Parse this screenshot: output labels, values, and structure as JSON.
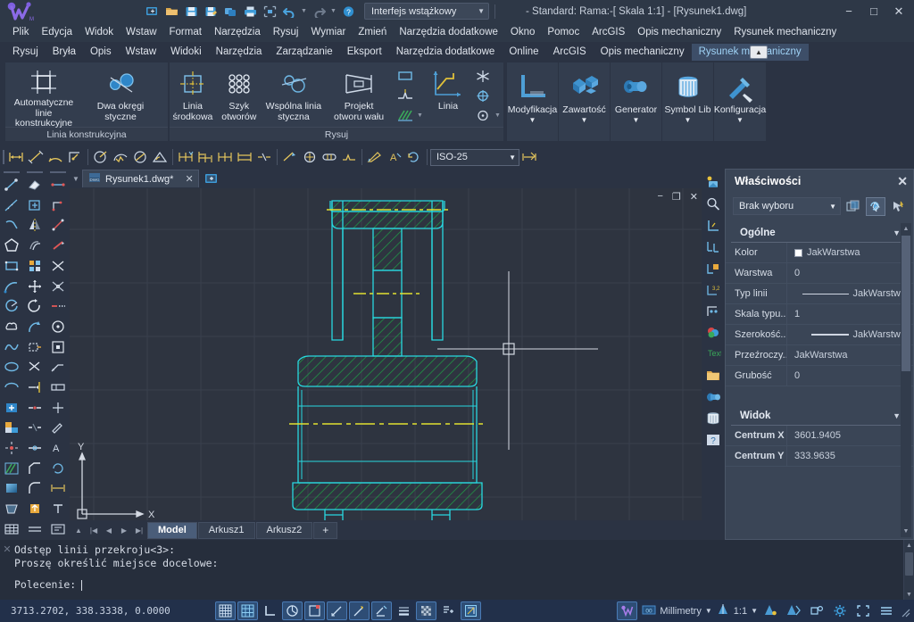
{
  "window": {
    "title": "- Standard: Rama:-[ Skala 1:1] - [Rysunek1.dwg]",
    "workspace_value": "Interfejs wstążkowy",
    "minimize": "−",
    "maximize": "□",
    "close": "✕"
  },
  "quick_access": [
    {
      "name": "new-icon",
      "glyph": "new"
    },
    {
      "name": "open-icon",
      "glyph": "open"
    },
    {
      "name": "save-icon",
      "glyph": "save"
    },
    {
      "name": "save-as-icon",
      "glyph": "saveas"
    },
    {
      "name": "plot-preview-icon",
      "glyph": "plotprev"
    },
    {
      "name": "print-icon",
      "glyph": "print"
    },
    {
      "name": "plot-region-icon",
      "glyph": "plotregion"
    },
    {
      "name": "undo-icon",
      "glyph": "undo"
    },
    {
      "name": "redo-icon",
      "glyph": "redo"
    },
    {
      "name": "help-icon",
      "glyph": "help"
    }
  ],
  "menu": [
    "Plik",
    "Edycja",
    "Widok",
    "Wstaw",
    "Format",
    "Narzędzia",
    "Rysuj",
    "Wymiar",
    "Zmień",
    "Narzędzia dodatkowe",
    "Okno",
    "Pomoc",
    "ArcGIS",
    "Opis mechaniczny",
    "Rysunek mechaniczny"
  ],
  "ribbon_tabs": [
    {
      "label": "Rysuj",
      "active": false
    },
    {
      "label": "Bryła",
      "active": false
    },
    {
      "label": "Opis",
      "active": false
    },
    {
      "label": "Wstaw",
      "active": false
    },
    {
      "label": "Widoki",
      "active": false
    },
    {
      "label": "Narzędzia",
      "active": false
    },
    {
      "label": "Zarządzanie",
      "active": false
    },
    {
      "label": "Eksport",
      "active": false
    },
    {
      "label": "Narzędzia dodatkowe",
      "active": false
    },
    {
      "label": "Online",
      "active": false
    },
    {
      "label": "ArcGIS",
      "active": false
    },
    {
      "label": "Opis mechaniczny",
      "active": false
    },
    {
      "label": "Rysunek mechaniczny",
      "active": true
    }
  ],
  "ribbon_panels": [
    {
      "title": "Linia konstrukcyjna",
      "buttons": [
        {
          "label": "Automatyczne linie\nkonstrukcyjne",
          "dropdown": true,
          "icon": "construction-lines-icon"
        },
        {
          "label": "Dwa okręgi\nstyczne",
          "dropdown": true,
          "icon": "two-tangent-circles-icon"
        }
      ]
    },
    {
      "title": "Rysuj",
      "buttons": [
        {
          "label": "Linia\nśrodkowa",
          "dropdown": false,
          "icon": "center-line-icon"
        },
        {
          "label": "Szyk\notworów",
          "dropdown": false,
          "icon": "hole-array-icon"
        },
        {
          "label": "Wspólna linia\nstyczna",
          "dropdown": false,
          "icon": "common-tangent-icon"
        },
        {
          "label": "Projekt\notworu wału",
          "dropdown": true,
          "icon": "shaft-hole-icon"
        },
        {
          "label": "Linia",
          "dropdown": false,
          "icon": "line-icon"
        }
      ],
      "small_icons": [
        "rectangle-icon",
        "section-line-icon",
        "star-burst-icon",
        "break-line-icon",
        "crosshair-target-icon",
        "hatch-icon",
        "circle-center-icon"
      ]
    }
  ],
  "ribbon_right_buttons": [
    {
      "label": "Modyfikacja",
      "dropdown": true,
      "icon": "modify-icon"
    },
    {
      "label": "Zawartość",
      "dropdown": true,
      "icon": "content-icon"
    },
    {
      "label": "Generator",
      "dropdown": true,
      "icon": "generator-icon"
    },
    {
      "label": "Symbol\nLib",
      "dropdown": true,
      "icon": "symbol-library-icon"
    },
    {
      "label": "Konfiguracja",
      "dropdown": true,
      "icon": "configuration-icon"
    }
  ],
  "dim_toolbar": {
    "style_value": "ISO-25",
    "icons": [
      "linear-dimension-icon",
      "aligned-dimension-icon",
      "arc-length-icon",
      "ordinate-dimension-icon",
      "radius-dimension-icon",
      "jogged-radius-icon",
      "diameter-dimension-icon",
      "angular-dimension-icon",
      "quick-dimension-icon",
      "baseline-dimension-icon",
      "continue-dimension-icon",
      "dimension-space-icon",
      "dimension-break-icon",
      "tolerance-icon",
      "center-mark-icon",
      "inspect-icon",
      "jogged-linear-icon",
      "edit-dimension-icon",
      "edit-dim-text-icon",
      "dimension-update-icon",
      "dimension-style-icon"
    ]
  },
  "left_palette": {
    "column1": [
      "line-icon",
      "construction-line-icon",
      "polyline-icon",
      "polygon-icon",
      "rectangle-icon",
      "arc-icon",
      "circle-icon",
      "revision-cloud-icon",
      "spline-icon",
      "ellipse-icon",
      "ellipse-arc-icon",
      "insert-block-icon",
      "make-block-icon",
      "point-icon",
      "hatch-icon",
      "gradient-icon",
      "region-icon",
      "table-icon"
    ],
    "column2": [
      "erase-icon",
      "copy-icon",
      "mirror-icon",
      "offset-icon",
      "array-icon",
      "move-icon",
      "rotate-icon",
      "scale-icon",
      "stretch-icon",
      "trim-icon",
      "extend-icon",
      "break-at-point-icon",
      "break-icon",
      "join-icon",
      "chamfer-icon",
      "fillet-icon",
      "explode-icon",
      "multiline-icon"
    ],
    "column3": [
      "dimension-linear-icon",
      "dimension-ordinate-icon",
      "dimension-aligned-icon",
      "dimension-radius-icon",
      "dimension-diameter-icon",
      "dimension-angular-icon",
      "quick-dimension-icon",
      "dimension-baseline-icon",
      "dimension-continue-icon",
      "leader-icon",
      "tolerance-icon",
      "center-mark-icon",
      "dimension-edit-icon",
      "dimension-text-edit-icon",
      "dimension-update-icon",
      "dimension-style-icon",
      "text-icon",
      "mtext-icon"
    ]
  },
  "right_palette": [
    "render-icon",
    "zoom-icon",
    "ucs-icon",
    "ucs-manager-icon",
    "ucs-named-icon",
    "ucs-move-icon",
    "ucs-origin-icon",
    "color-icon",
    "text-style-icon",
    "layer-icon",
    "layer-tools-icon",
    "delete-layer-icon",
    "help-icon"
  ],
  "document_tab": {
    "label": "Rysunek1.dwg*",
    "close": "✕"
  },
  "canvas": {
    "minimize": "−",
    "restore": "❐",
    "close": "✕",
    "ucs_x_label": "X",
    "ucs_y_label": "Y"
  },
  "layout_tabs": [
    {
      "label": "Model",
      "active": true
    },
    {
      "label": "Arkusz1",
      "active": false
    },
    {
      "label": "Arkusz2",
      "active": false
    },
    {
      "label": "+",
      "active": false
    }
  ],
  "command_line": {
    "history": [
      "Odstęp linii przekroju<3>:",
      "Proszę określić miejsce docelowe:"
    ],
    "prompt": "Polecenie:"
  },
  "status_bar": {
    "coords": "3713.2702, 338.3338, 0.0000",
    "left_toggles": [
      {
        "name": "grid-display-toggle",
        "on": true
      },
      {
        "name": "snap-mode-toggle",
        "on": true
      },
      {
        "name": "ortho-mode-toggle",
        "on": false
      },
      {
        "name": "polar-tracking-toggle",
        "on": true
      },
      {
        "name": "object-snap-toggle",
        "on": true
      },
      {
        "name": "object-snap-tracking-toggle",
        "on": true
      },
      {
        "name": "dynamic-ucs-toggle",
        "on": true
      },
      {
        "name": "dynamic-input-toggle",
        "on": true
      },
      {
        "name": "lineweight-toggle",
        "on": false
      },
      {
        "name": "transparency-toggle",
        "on": true
      },
      {
        "name": "quick-properties-toggle",
        "on": false
      },
      {
        "name": "selection-cycling-toggle",
        "on": true
      }
    ],
    "unit_label": "Millimetry",
    "scale_label": "1:1",
    "right_icons": [
      "annotation-visibility-icon",
      "annotation-scale-auto-icon",
      "workspace-switch-icon",
      "settings-icon",
      "fullscreen-icon",
      "customization-icon"
    ]
  },
  "properties": {
    "title": "Właściwości",
    "close": "✕",
    "selection_value": "Brak wyboru",
    "tool_buttons": [
      {
        "name": "select-objects-button",
        "active": false
      },
      {
        "name": "quick-select-button",
        "active": true
      },
      {
        "name": "pick-filter-button",
        "active": false
      }
    ],
    "groups": [
      {
        "name": "Ogólne",
        "rows": [
          {
            "key": "Kolor",
            "value": "JakWarstwa",
            "type": "color"
          },
          {
            "key": "Warstwa",
            "value": "0",
            "type": "text"
          },
          {
            "key": "Typ linii",
            "value": "JakWarstwa",
            "type": "linetype"
          },
          {
            "key": "Skala typu...",
            "value": "1",
            "type": "text"
          },
          {
            "key": "Szerokość...",
            "value": "JakWarstwa",
            "type": "lineweight"
          },
          {
            "key": "Przeźroczy...",
            "value": "JakWarstwa",
            "type": "text"
          },
          {
            "key": "Grubość",
            "value": "0",
            "type": "text"
          }
        ]
      },
      {
        "name": "Widok",
        "rows": [
          {
            "key": "Centrum X",
            "value": "3601.9405",
            "type": "text"
          },
          {
            "key": "Centrum Y",
            "value": "333.9635",
            "type": "text"
          }
        ]
      }
    ]
  },
  "colors": {
    "accent": "#3d9bd8",
    "canvas_bg": "#2e3440",
    "geometry": "#28d8e0",
    "hatch": "#22b14c",
    "centerline": "#e0e030",
    "crosshair": "#d5dae3"
  }
}
